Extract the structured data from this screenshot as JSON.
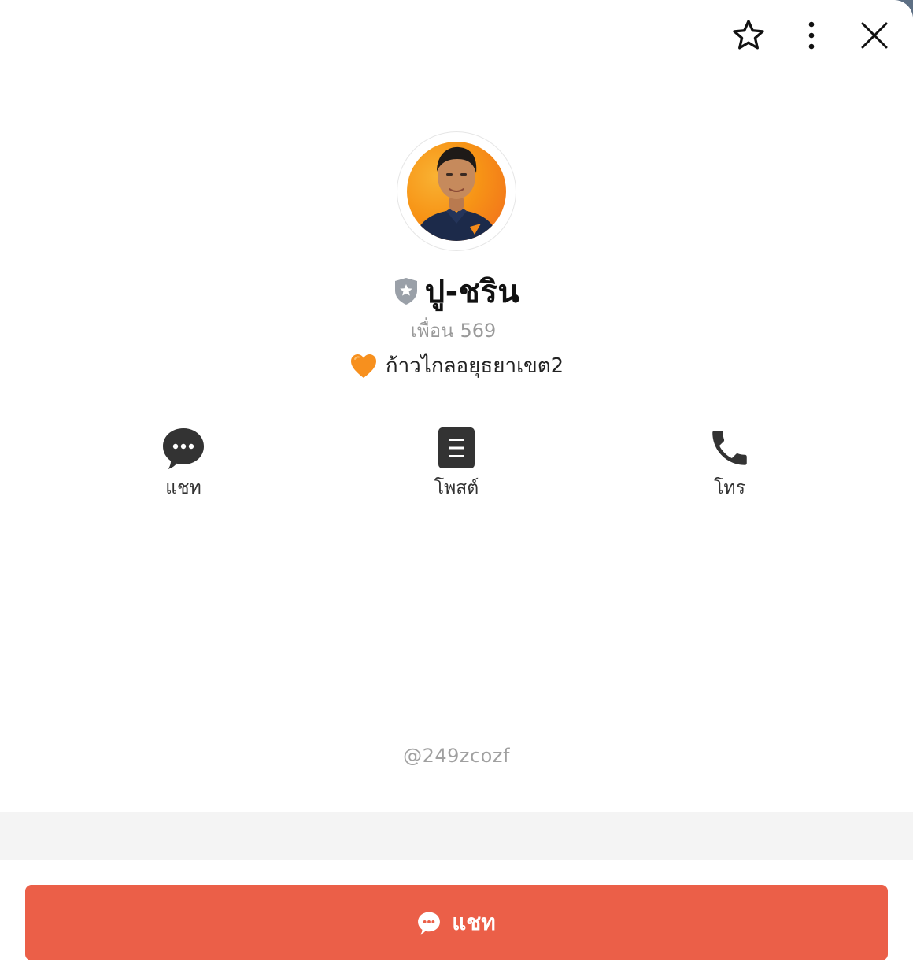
{
  "colors": {
    "accent": "#eb5f48",
    "icon_dark": "#333333",
    "secondary_text": "#9a9a9a",
    "divider_band": "#f4f4f4",
    "heart": "#f7901e"
  },
  "top_bar": {
    "icons": [
      "star-outline-icon",
      "more-vertical-icon",
      "close-icon"
    ]
  },
  "profile": {
    "avatar_icon": "profile-photo",
    "badge_icon": "verified-shield-icon",
    "name": "ปู-ชริน",
    "friends_label": "เพื่อน",
    "friends_count": "569",
    "status_emoji_icon": "orange-heart-icon",
    "status_message": "ก้าวไกลอยุธยาเขต2",
    "handle": "@249zcozf"
  },
  "actions": [
    {
      "icon": "chat-bubble-icon",
      "label": "แชท"
    },
    {
      "icon": "post-document-icon",
      "label": "โพสต์"
    },
    {
      "icon": "phone-icon",
      "label": "โทร"
    }
  ],
  "primary_button": {
    "icon": "chat-bubble-icon",
    "label": "แชท"
  }
}
